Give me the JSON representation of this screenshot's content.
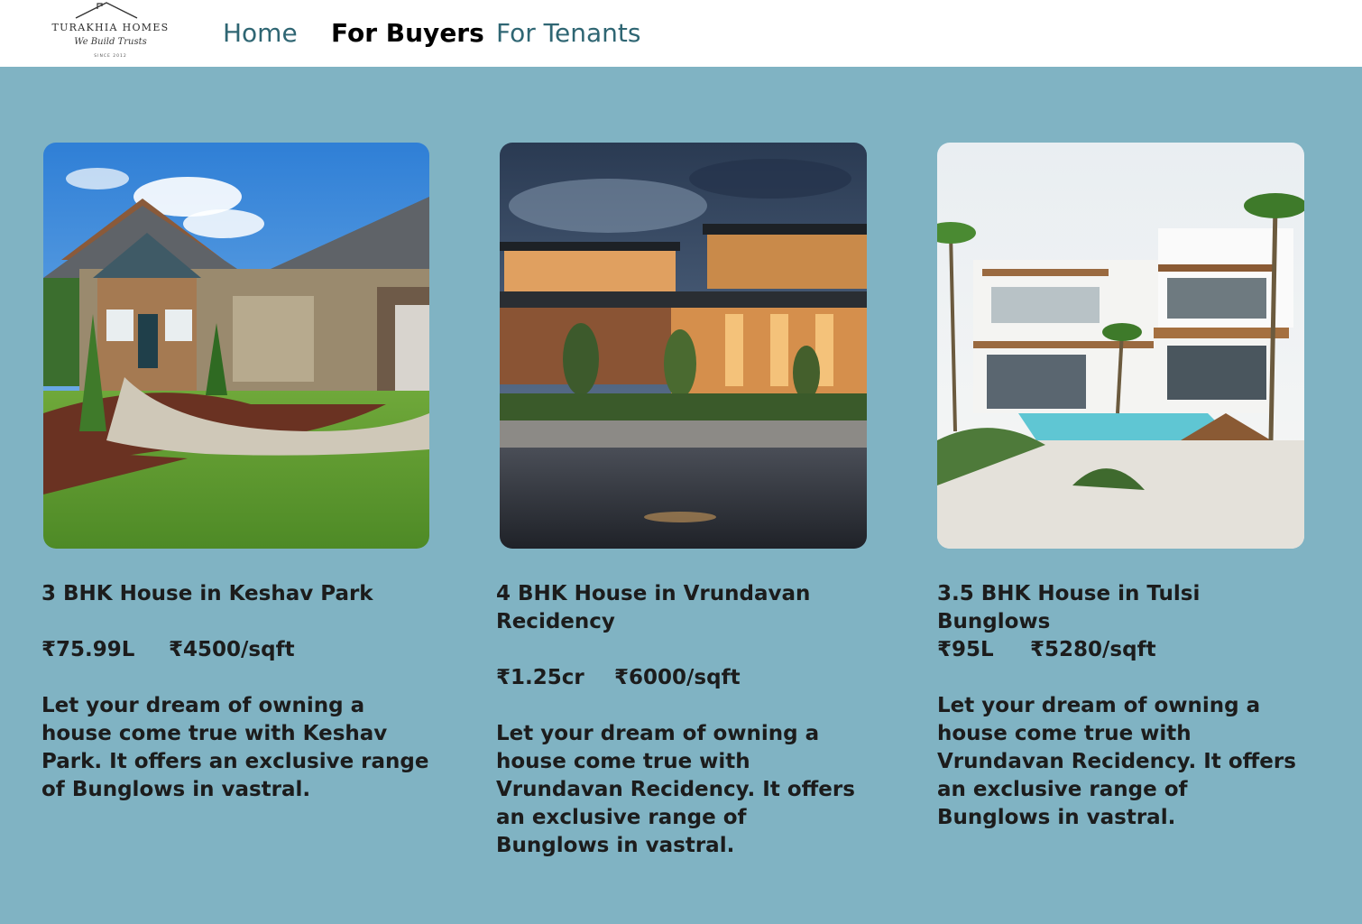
{
  "brand": {
    "name": "TURAKHIA HOMES",
    "tagline": "We Build Trusts",
    "since": "SINCE 2012"
  },
  "nav": {
    "home": "Home",
    "buyers": "For Buyers",
    "tenants": "For Tenants"
  },
  "listings": [
    {
      "title": "3 BHK House in Keshav Park",
      "price": "₹75.99L",
      "rate": "₹4500/sqft",
      "description": "Let your dream of owning a house come true with Keshav Park. It offers an exclusive range of Bunglows in vastral.",
      "image": "suburban-craftsman-house-photo"
    },
    {
      "title": "4 BHK House in Vrundavan Recidency",
      "price": "₹1.25cr",
      "rate": "₹6000/sqft",
      "description": "Let your dream of owning a house come true with Vrundavan Recidency. It offers an exclusive range of Bunglows in vastral.",
      "image": "modern-house-dusk-photo"
    },
    {
      "title": "3.5 BHK House in Tulsi Bunglows",
      "price": "₹95L",
      "rate": "₹5280/sqft",
      "description": "Let your dream of owning a house come true with Vrundavan Recidency. It offers an exclusive range of Bunglows in vastral.",
      "image": "white-villa-pool-photo"
    }
  ]
}
